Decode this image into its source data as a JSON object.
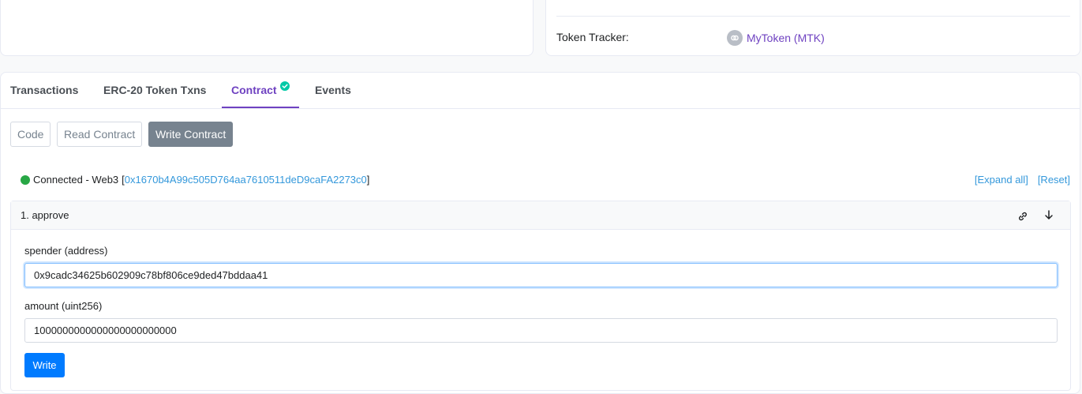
{
  "token_tracker": {
    "label": "Token Tracker:",
    "token_name": "MyToken (MTK)"
  },
  "tabs": [
    {
      "label": "Transactions",
      "active": false
    },
    {
      "label": "ERC-20 Token Txns",
      "active": false
    },
    {
      "label": "Contract",
      "active": true,
      "verified": true
    },
    {
      "label": "Events",
      "active": false
    }
  ],
  "sub_buttons": [
    {
      "label": "Code",
      "active": false
    },
    {
      "label": "Read Contract",
      "active": false
    },
    {
      "label": "Write Contract",
      "active": true
    }
  ],
  "connection": {
    "status": "Connected - Web3",
    "open_bracket": "[",
    "address": "0x1670b4A99c505D764aa7610511deD9caFA2273c0",
    "close_bracket": "]"
  },
  "actions": {
    "expand_all": "[Expand all]",
    "reset": "[Reset]"
  },
  "function": {
    "title": "1. approve",
    "inputs": [
      {
        "label": "spender (address)",
        "value": "0x9cadc34625b602909c78bf806ce9ded47bddaa41"
      },
      {
        "label": "amount (uint256)",
        "value": "1000000000000000000000000"
      }
    ],
    "button_label": "Write"
  },
  "colors": {
    "accent": "#6f42c1",
    "link": "#3498db",
    "primary_button": "#007bff",
    "connected": "#28a745"
  }
}
